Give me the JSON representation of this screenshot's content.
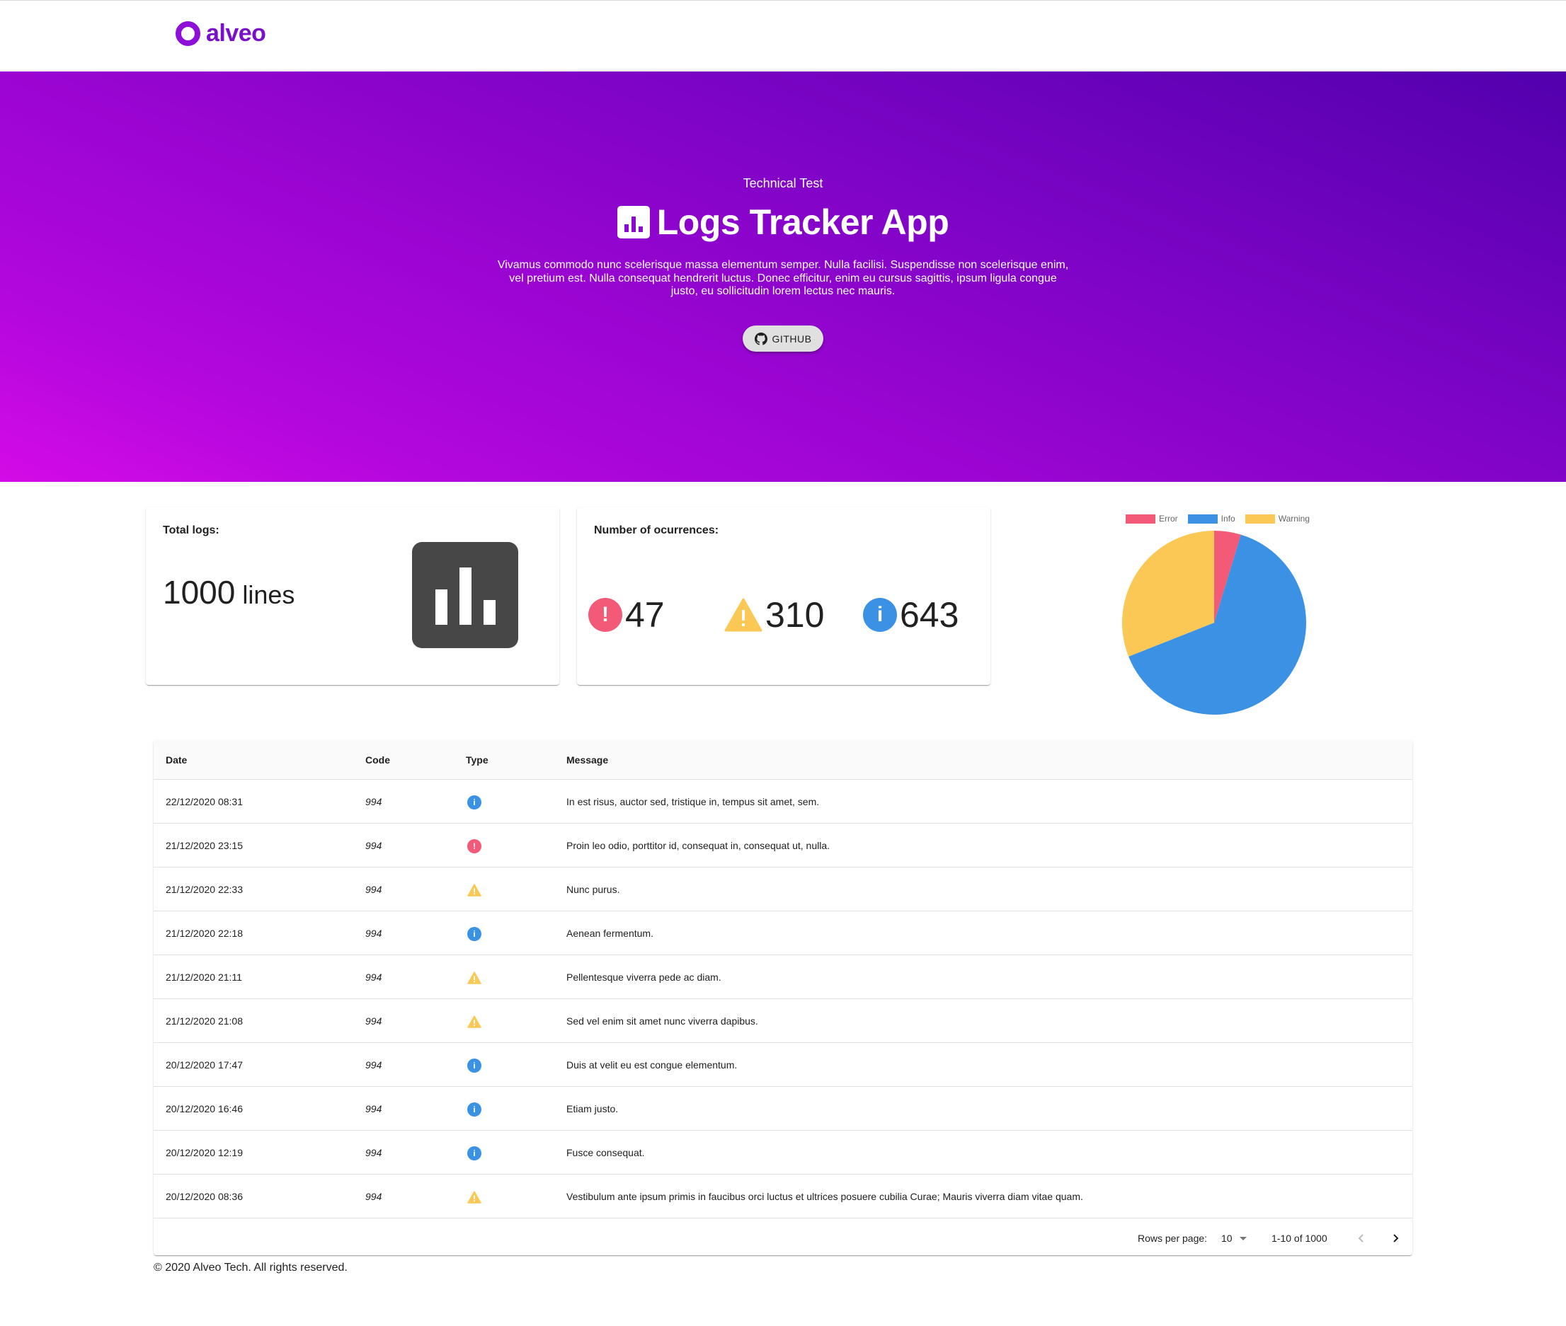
{
  "header": {
    "logo_text": "alveo",
    "brand_color": "#8e10d8"
  },
  "hero": {
    "subtitle": "Technical Test",
    "title": "Logs Tracker App",
    "description": "Vivamus commodo nunc scelerisque massa elementum semper. Nulla facilisi. Suspendisse non scelerisque enim, vel pretium est. Nulla consequat hendrerit luctus. Donec efficitur, enim eu cursus sagittis, ipsum ligula congue justo, eu sollicitudin lorem lectus nec mauris.",
    "github_label": "GITHUB",
    "gradient": [
      "#d40be6",
      "#5200ae"
    ]
  },
  "stats": {
    "total_label": "Total logs:",
    "total_value": "1000",
    "total_unit": "lines",
    "occurrences_label": "Number of ocurrences:",
    "error_count": "47",
    "warning_count": "310",
    "info_count": "643"
  },
  "colors": {
    "error": "#f25a78",
    "info": "#3b92e4",
    "warning": "#fcc855"
  },
  "chart_data": {
    "type": "pie",
    "categories": [
      "Error",
      "Info",
      "Warning"
    ],
    "values": [
      47,
      643,
      310
    ],
    "colors": [
      "#f25a78",
      "#3b92e4",
      "#fcc855"
    ],
    "legend": "top"
  },
  "table": {
    "columns": [
      "Date",
      "Code",
      "Type",
      "Message"
    ],
    "rows": [
      {
        "date": "22/12/2020 08:31",
        "code": "994",
        "type": "info",
        "message": "In est risus, auctor sed, tristique in, tempus sit amet, sem."
      },
      {
        "date": "21/12/2020 23:15",
        "code": "994",
        "type": "error",
        "message": "Proin leo odio, porttitor id, consequat in, consequat ut, nulla."
      },
      {
        "date": "21/12/2020 22:33",
        "code": "994",
        "type": "warning",
        "message": "Nunc purus."
      },
      {
        "date": "21/12/2020 22:18",
        "code": "994",
        "type": "info",
        "message": "Aenean fermentum."
      },
      {
        "date": "21/12/2020 21:11",
        "code": "994",
        "type": "warning",
        "message": "Pellentesque viverra pede ac diam."
      },
      {
        "date": "21/12/2020 21:08",
        "code": "994",
        "type": "warning",
        "message": "Sed vel enim sit amet nunc viverra dapibus."
      },
      {
        "date": "20/12/2020 17:47",
        "code": "994",
        "type": "info",
        "message": "Duis at velit eu est congue elementum."
      },
      {
        "date": "20/12/2020 16:46",
        "code": "994",
        "type": "info",
        "message": "Etiam justo."
      },
      {
        "date": "20/12/2020 12:19",
        "code": "994",
        "type": "info",
        "message": "Fusce consequat."
      },
      {
        "date": "20/12/2020 08:36",
        "code": "994",
        "type": "warning",
        "message": "Vestibulum ante ipsum primis in faucibus orci luctus et ultrices posuere cubilia Curae; Mauris viverra diam vitae quam."
      }
    ],
    "pagination": {
      "rows_per_page_label": "Rows per page:",
      "rows_per_page": "10",
      "range": "1-10 of 1000"
    }
  },
  "footer": {
    "copyright": "© 2020 Alveo Tech. All rights reserved."
  }
}
